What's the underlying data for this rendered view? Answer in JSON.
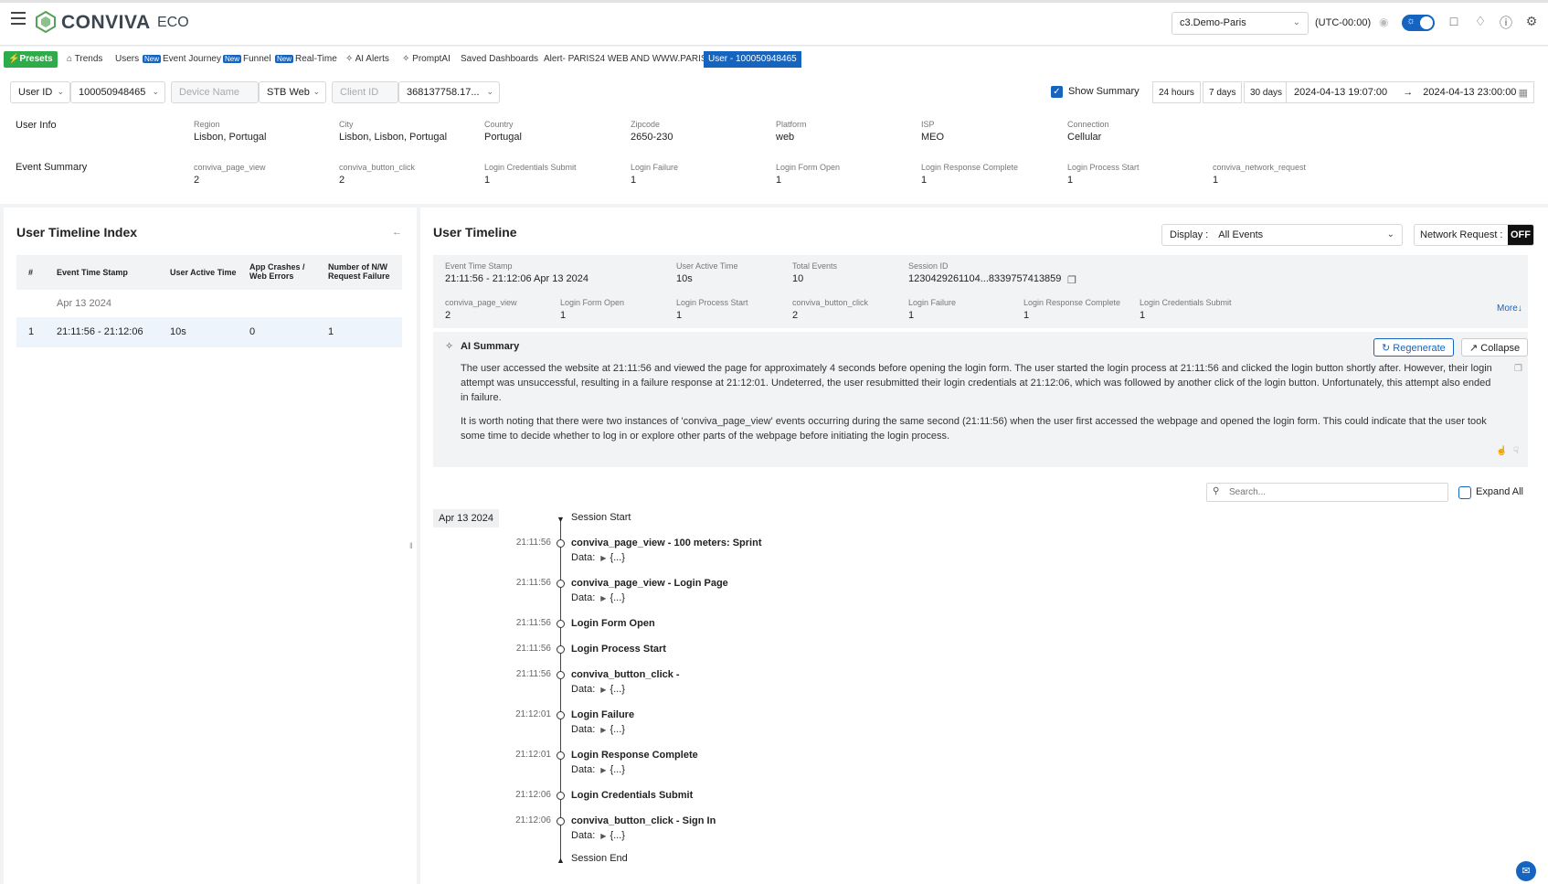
{
  "header": {
    "logo": "CONVIVA",
    "logo_suffix": "ECO",
    "account": "c3.Demo-Paris",
    "timezone": "(UTC-00:00)"
  },
  "tabs": [
    {
      "label": "Presets"
    },
    {
      "label": "Trends"
    },
    {
      "label": "Users"
    },
    {
      "label": "Event Journey",
      "badge": "New"
    },
    {
      "label": "Funnel",
      "badge": "New"
    },
    {
      "label": "Real-Time",
      "badge": "New"
    },
    {
      "label": "AI Alerts"
    },
    {
      "label": "PromptAI"
    },
    {
      "label": "Saved Dashboards"
    },
    {
      "label": "Alert- PARIS24 WEB AND WWW.PARIS..."
    },
    {
      "label": "User - 100050948465"
    }
  ],
  "filters": {
    "id_type": "User ID",
    "id_value": "100050948465",
    "device_name_placeholder": "Device Name",
    "platform": "STB Web",
    "client_id_placeholder": "Client ID",
    "client_id_value": "368137758.17...",
    "show_summary": "Show Summary",
    "ranges": [
      "24 hours",
      "7 days",
      "30 days"
    ],
    "date_from": "2024-04-13 19:07:00",
    "date_to": "2024-04-13 23:00:00"
  },
  "user_info": {
    "title": "User Info",
    "fields": [
      {
        "label": "Region",
        "value": "Lisbon, Portugal"
      },
      {
        "label": "City",
        "value": "Lisbon, Lisbon, Portugal"
      },
      {
        "label": "Country",
        "value": "Portugal"
      },
      {
        "label": "Zipcode",
        "value": "2650-230"
      },
      {
        "label": "Platform",
        "value": "web"
      },
      {
        "label": "ISP",
        "value": "MEO"
      },
      {
        "label": "Connection",
        "value": "Cellular"
      }
    ]
  },
  "event_summary": {
    "title": "Event Summary",
    "fields": [
      {
        "label": "conviva_page_view",
        "value": "2"
      },
      {
        "label": "conviva_button_click",
        "value": "2"
      },
      {
        "label": "Login Credentials Submit",
        "value": "1"
      },
      {
        "label": "Login Failure",
        "value": "1"
      },
      {
        "label": "Login Form Open",
        "value": "1"
      },
      {
        "label": "Login Response Complete",
        "value": "1"
      },
      {
        "label": "Login Process Start",
        "value": "1"
      },
      {
        "label": "conviva_network_request",
        "value": "1"
      }
    ]
  },
  "timeline_index": {
    "title": "User Timeline Index",
    "columns": [
      "#",
      "Event Time Stamp",
      "User Active Time",
      "App Crashes / Web Errors",
      "Number of N/W Request Failure"
    ],
    "date": "Apr 13 2024",
    "rows": [
      {
        "num": "1",
        "stamp": "21:11:56 - 21:12:06",
        "active": "10s",
        "crashes": "0",
        "failures": "1"
      }
    ]
  },
  "timeline": {
    "title": "User Timeline",
    "display_label": "Display :",
    "display_value": "All Events",
    "network_label": "Network Request :",
    "network_state": "OFF",
    "summary": {
      "row1": [
        {
          "label": "Event Time Stamp",
          "value": "21:11:56 - 21:12:06 Apr 13 2024"
        },
        {
          "label": "User Active Time",
          "value": "10s"
        },
        {
          "label": "Total Events",
          "value": "10"
        },
        {
          "label": "Session ID",
          "value": "1230429261104...8339757413859"
        }
      ],
      "row2": [
        {
          "label": "conviva_page_view",
          "value": "2"
        },
        {
          "label": "Login Form Open",
          "value": "1"
        },
        {
          "label": "Login Process Start",
          "value": "1"
        },
        {
          "label": "conviva_button_click",
          "value": "2"
        },
        {
          "label": "Login Failure",
          "value": "1"
        },
        {
          "label": "Login Response Complete",
          "value": "1"
        },
        {
          "label": "Login Credentials Submit",
          "value": "1"
        }
      ],
      "more": "More"
    },
    "ai": {
      "title": "AI Summary",
      "regenerate": "Regenerate",
      "collapse": "Collapse",
      "para1": "The user accessed the website at 21:11:56 and viewed the page for approximately 4 seconds before opening the login form. The user started the login process at 21:11:56 and clicked the login button shortly after. However, their login attempt was unsuccessful, resulting in a failure response at 21:12:01. Undeterred, the user resubmitted their login credentials at 21:12:06, which was followed by another click of the login button. Unfortunately, this attempt also ended in failure.",
      "para2": "It is worth noting that there were two instances of 'conviva_page_view' events occurring during the same second (21:11:56) when the user first accessed the webpage and opened the login form. This could indicate that the user took some time to decide whether to log in or explore other parts of the webpage before initiating the login process."
    },
    "search_placeholder": "Search...",
    "expand_all": "Expand All",
    "date": "Apr 13 2024",
    "session_start": "Session Start",
    "session_end": "Session End",
    "data_label": "Data:",
    "data_value": "{...}",
    "events": [
      {
        "time": "21:11:56",
        "name": "conviva_page_view - 100 meters: Sprint",
        "has_data": true
      },
      {
        "time": "21:11:56",
        "name": "conviva_page_view - Login Page",
        "has_data": true
      },
      {
        "time": "21:11:56",
        "name": "Login Form Open",
        "has_data": false
      },
      {
        "time": "21:11:56",
        "name": "Login Process Start",
        "has_data": false
      },
      {
        "time": "21:11:56",
        "name": "conviva_button_click -",
        "has_data": true
      },
      {
        "time": "21:12:01",
        "name": "Login Failure",
        "has_data": true
      },
      {
        "time": "21:12:01",
        "name": "Login Response Complete",
        "has_data": true
      },
      {
        "time": "21:12:06",
        "name": "Login Credentials Submit",
        "has_data": false
      },
      {
        "time": "21:12:06",
        "name": "conviva_button_click - Sign In",
        "has_data": true
      }
    ]
  }
}
